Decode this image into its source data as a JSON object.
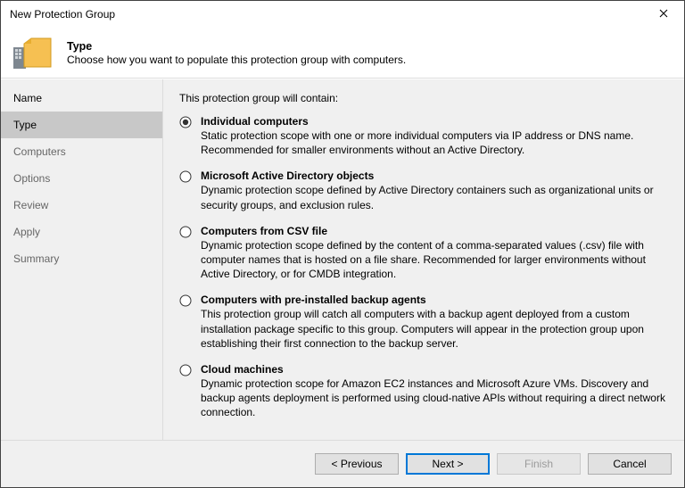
{
  "window": {
    "title": "New Protection Group"
  },
  "header": {
    "title": "Type",
    "subtitle": "Choose how you want to populate this protection group with computers."
  },
  "sidebar": {
    "header": "Name",
    "items": [
      {
        "label": "Type",
        "active": true
      },
      {
        "label": "Computers",
        "active": false
      },
      {
        "label": "Options",
        "active": false
      },
      {
        "label": "Review",
        "active": false
      },
      {
        "label": "Apply",
        "active": false
      },
      {
        "label": "Summary",
        "active": false
      }
    ]
  },
  "content": {
    "intro": "This protection group will contain:",
    "options": [
      {
        "selected": true,
        "title": "Individual computers",
        "desc": "Static protection scope with one or more individual computers via IP address or DNS name. Recommended for smaller environments without an Active Directory."
      },
      {
        "selected": false,
        "title": "Microsoft Active Directory objects",
        "desc": "Dynamic protection scope defined by Active Directory containers such as organizational units or security groups, and exclusion rules."
      },
      {
        "selected": false,
        "title": "Computers from CSV file",
        "desc": "Dynamic protection scope defined by the content of a comma-separated values (.csv) file with computer names that is hosted on a file share. Recommended for larger environments without Active Directory, or for CMDB integration."
      },
      {
        "selected": false,
        "title": "Computers with pre-installed backup agents",
        "desc": "This protection group will catch all computers with a backup agent deployed from a custom installation package specific to this group.  Computers will appear in the protection group upon establishing their first connection to the backup server."
      },
      {
        "selected": false,
        "title": "Cloud machines",
        "desc": "Dynamic protection scope for Amazon EC2 instances and Microsoft Azure VMs. Discovery and backup agents deployment is performed using cloud-native APIs without requiring a direct network connection."
      }
    ]
  },
  "footer": {
    "previous": "< Previous",
    "next": "Next >",
    "finish": "Finish",
    "cancel": "Cancel"
  }
}
